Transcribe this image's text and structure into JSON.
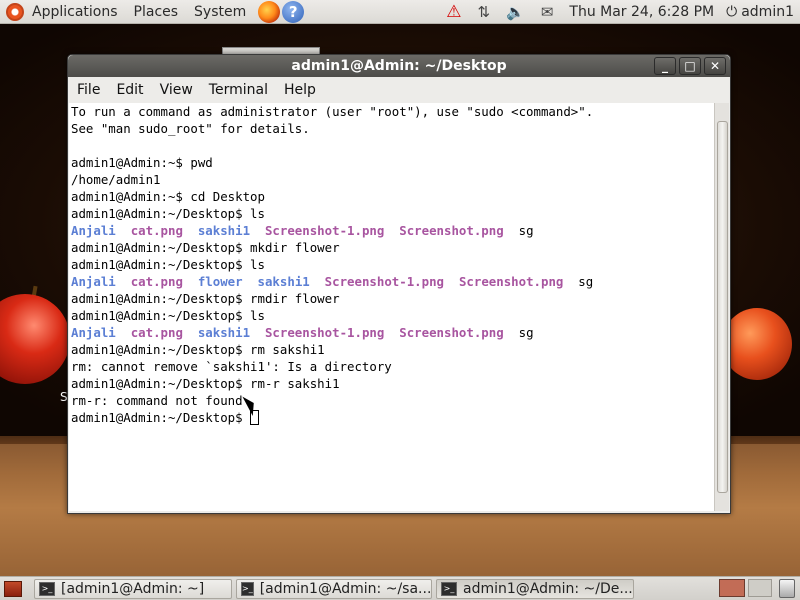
{
  "top_panel": {
    "menus": [
      "Applications",
      "Places",
      "System"
    ],
    "icons": [
      "ubuntu-logo-icon",
      "firefox-icon",
      "help-icon",
      "warning-icon",
      "network-icon",
      "volume-icon",
      "mail-icon",
      "power-icon"
    ],
    "help_glyph": "?",
    "clock": "Thu Mar 24,  6:28 PM",
    "user": "admin1"
  },
  "window": {
    "title": "admin1@Admin: ~/Desktop",
    "menu": [
      "File",
      "Edit",
      "View",
      "Terminal",
      "Help"
    ],
    "buttons": {
      "minimize": "_",
      "maximize": "□",
      "close": "✕"
    }
  },
  "terminal": {
    "lines": [
      {
        "text": "To run a command as administrator (user \"root\"), use \"sudo <command>\"."
      },
      {
        "text": "See \"man sudo_root\" for details."
      },
      {
        "text": ""
      },
      {
        "text": "admin1@Admin:~$ pwd"
      },
      {
        "text": "/home/admin1"
      },
      {
        "text": "admin1@Admin:~$ cd Desktop"
      },
      {
        "text": "admin1@Admin:~/Desktop$ ls"
      },
      {
        "ls": [
          {
            "name": "Anjali",
            "color": "blue"
          },
          {
            "name": "cat.png",
            "color": "magenta"
          },
          {
            "name": "sakshi1",
            "color": "blue"
          },
          {
            "name": "Screenshot-1.png",
            "color": "magenta"
          },
          {
            "name": "Screenshot.png",
            "color": "magenta"
          },
          {
            "name": "sg",
            "color": "plain"
          }
        ]
      },
      {
        "text": "admin1@Admin:~/Desktop$ mkdir flower"
      },
      {
        "text": "admin1@Admin:~/Desktop$ ls"
      },
      {
        "ls": [
          {
            "name": "Anjali",
            "color": "blue"
          },
          {
            "name": "cat.png",
            "color": "magenta"
          },
          {
            "name": "flower",
            "color": "blue"
          },
          {
            "name": "sakshi1",
            "color": "blue"
          },
          {
            "name": "Screenshot-1.png",
            "color": "magenta"
          },
          {
            "name": "Screenshot.png",
            "color": "magenta"
          },
          {
            "name": "sg",
            "color": "plain"
          }
        ]
      },
      {
        "text": "admin1@Admin:~/Desktop$ rmdir flower"
      },
      {
        "text": "admin1@Admin:~/Desktop$ ls"
      },
      {
        "ls": [
          {
            "name": "Anjali",
            "color": "blue"
          },
          {
            "name": "cat.png",
            "color": "magenta"
          },
          {
            "name": "sakshi1",
            "color": "blue"
          },
          {
            "name": "Screenshot-1.png",
            "color": "magenta"
          },
          {
            "name": "Screenshot.png",
            "color": "magenta"
          },
          {
            "name": "sg",
            "color": "plain"
          }
        ]
      },
      {
        "text": "admin1@Admin:~/Desktop$ rm sakshi1"
      },
      {
        "text": "rm: cannot remove `sakshi1': Is a directory"
      },
      {
        "text": "admin1@Admin:~/Desktop$ rm-r sakshi1"
      },
      {
        "text": "rm-r: command not found"
      },
      {
        "text": "admin1@Admin:~/Desktop$ ",
        "cursor": true
      }
    ]
  },
  "desktop": {
    "partial_label": "S"
  },
  "taskbar": {
    "tasks": [
      {
        "label": "[admin1@Admin: ~]",
        "active": false
      },
      {
        "label": "[admin1@Admin: ~/sa...",
        "active": false
      },
      {
        "label": "admin1@Admin: ~/De...",
        "active": true
      }
    ]
  },
  "colors": {
    "ls_directory": "#5c7fd4",
    "ls_image": "#a855a0",
    "titlebar": "#4d4c49"
  }
}
